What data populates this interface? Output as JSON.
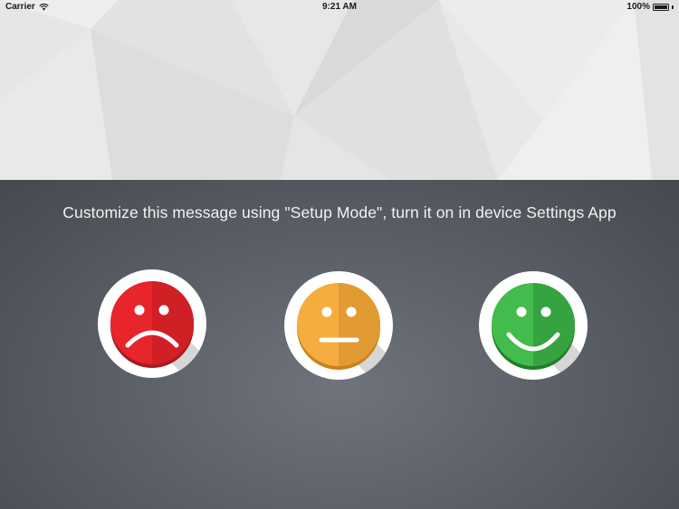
{
  "status_bar": {
    "carrier": "Carrier",
    "time": "9:21 AM",
    "battery": "100%",
    "wifi_icon": "wifi-icon",
    "battery_icon": "battery-icon"
  },
  "message": "Customize this message using \"Setup Mode\", turn it on in device Settings App",
  "faces": [
    {
      "name": "sad",
      "icon": "sad-face-icon",
      "color": "#e02a2f"
    },
    {
      "name": "neutral",
      "icon": "neutral-face-icon",
      "color": "#f1ab3c"
    },
    {
      "name": "happy",
      "icon": "happy-face-icon",
      "color": "#3fb54a"
    }
  ],
  "colors": {
    "banner_background": "#ebebeb",
    "panel_background": "#565a62",
    "text": "#f2f2f2"
  }
}
